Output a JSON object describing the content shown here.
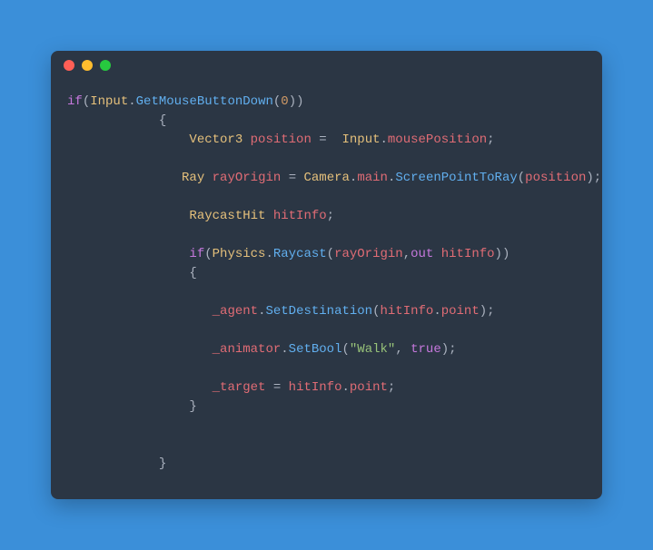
{
  "window": {
    "dots": [
      "red",
      "yellow",
      "green"
    ]
  },
  "code": {
    "lines": [
      [
        {
          "cls": "k",
          "t": "if"
        },
        {
          "cls": "p",
          "t": "("
        },
        {
          "cls": "c",
          "t": "Input"
        },
        {
          "cls": "p",
          "t": "."
        },
        {
          "cls": "m",
          "t": "GetMouseButtonDown"
        },
        {
          "cls": "p",
          "t": "("
        },
        {
          "cls": "n",
          "t": "0"
        },
        {
          "cls": "p",
          "t": "))"
        }
      ],
      [
        {
          "cls": "w",
          "t": "            "
        },
        {
          "cls": "p",
          "t": "{"
        }
      ],
      [
        {
          "cls": "w",
          "t": "                "
        },
        {
          "cls": "c",
          "t": "Vector3"
        },
        {
          "cls": "w",
          "t": " "
        },
        {
          "cls": "v",
          "t": "position"
        },
        {
          "cls": "w",
          "t": " "
        },
        {
          "cls": "p",
          "t": "="
        },
        {
          "cls": "w",
          "t": "  "
        },
        {
          "cls": "c",
          "t": "Input"
        },
        {
          "cls": "p",
          "t": "."
        },
        {
          "cls": "v",
          "t": "mousePosition"
        },
        {
          "cls": "p",
          "t": ";"
        }
      ],
      [
        {
          "cls": "w",
          "t": ""
        }
      ],
      [
        {
          "cls": "w",
          "t": "               "
        },
        {
          "cls": "c",
          "t": "Ray"
        },
        {
          "cls": "w",
          "t": " "
        },
        {
          "cls": "v",
          "t": "rayOrigin"
        },
        {
          "cls": "w",
          "t": " "
        },
        {
          "cls": "p",
          "t": "="
        },
        {
          "cls": "w",
          "t": " "
        },
        {
          "cls": "c",
          "t": "Camera"
        },
        {
          "cls": "p",
          "t": "."
        },
        {
          "cls": "v",
          "t": "main"
        },
        {
          "cls": "p",
          "t": "."
        },
        {
          "cls": "m",
          "t": "ScreenPointToRay"
        },
        {
          "cls": "p",
          "t": "("
        },
        {
          "cls": "v",
          "t": "position"
        },
        {
          "cls": "p",
          "t": ");"
        }
      ],
      [
        {
          "cls": "w",
          "t": ""
        }
      ],
      [
        {
          "cls": "w",
          "t": "                "
        },
        {
          "cls": "c",
          "t": "RaycastHit"
        },
        {
          "cls": "w",
          "t": " "
        },
        {
          "cls": "v",
          "t": "hitInfo"
        },
        {
          "cls": "p",
          "t": ";"
        }
      ],
      [
        {
          "cls": "w",
          "t": ""
        }
      ],
      [
        {
          "cls": "w",
          "t": "                "
        },
        {
          "cls": "k",
          "t": "if"
        },
        {
          "cls": "p",
          "t": "("
        },
        {
          "cls": "c",
          "t": "Physics"
        },
        {
          "cls": "p",
          "t": "."
        },
        {
          "cls": "m",
          "t": "Raycast"
        },
        {
          "cls": "p",
          "t": "("
        },
        {
          "cls": "v",
          "t": "rayOrigin"
        },
        {
          "cls": "p",
          "t": ","
        },
        {
          "cls": "k",
          "t": "out"
        },
        {
          "cls": "w",
          "t": " "
        },
        {
          "cls": "v",
          "t": "hitInfo"
        },
        {
          "cls": "p",
          "t": "))"
        }
      ],
      [
        {
          "cls": "w",
          "t": "                "
        },
        {
          "cls": "p",
          "t": "{"
        }
      ],
      [
        {
          "cls": "w",
          "t": ""
        }
      ],
      [
        {
          "cls": "w",
          "t": "                   "
        },
        {
          "cls": "v",
          "t": "_agent"
        },
        {
          "cls": "p",
          "t": "."
        },
        {
          "cls": "m",
          "t": "SetDestination"
        },
        {
          "cls": "p",
          "t": "("
        },
        {
          "cls": "v",
          "t": "hitInfo"
        },
        {
          "cls": "p",
          "t": "."
        },
        {
          "cls": "v",
          "t": "point"
        },
        {
          "cls": "p",
          "t": ");"
        }
      ],
      [
        {
          "cls": "w",
          "t": ""
        }
      ],
      [
        {
          "cls": "w",
          "t": "                   "
        },
        {
          "cls": "v",
          "t": "_animator"
        },
        {
          "cls": "p",
          "t": "."
        },
        {
          "cls": "m",
          "t": "SetBool"
        },
        {
          "cls": "p",
          "t": "("
        },
        {
          "cls": "s",
          "t": "\"Walk\""
        },
        {
          "cls": "p",
          "t": ", "
        },
        {
          "cls": "k",
          "t": "true"
        },
        {
          "cls": "p",
          "t": ");"
        }
      ],
      [
        {
          "cls": "w",
          "t": ""
        }
      ],
      [
        {
          "cls": "w",
          "t": "                   "
        },
        {
          "cls": "v",
          "t": "_target"
        },
        {
          "cls": "w",
          "t": " "
        },
        {
          "cls": "p",
          "t": "="
        },
        {
          "cls": "w",
          "t": " "
        },
        {
          "cls": "v",
          "t": "hitInfo"
        },
        {
          "cls": "p",
          "t": "."
        },
        {
          "cls": "v",
          "t": "point"
        },
        {
          "cls": "p",
          "t": ";"
        }
      ],
      [
        {
          "cls": "w",
          "t": "                "
        },
        {
          "cls": "p",
          "t": "}"
        }
      ],
      [
        {
          "cls": "w",
          "t": ""
        }
      ],
      [
        {
          "cls": "w",
          "t": ""
        }
      ],
      [
        {
          "cls": "w",
          "t": "            "
        },
        {
          "cls": "p",
          "t": "}"
        }
      ]
    ]
  }
}
